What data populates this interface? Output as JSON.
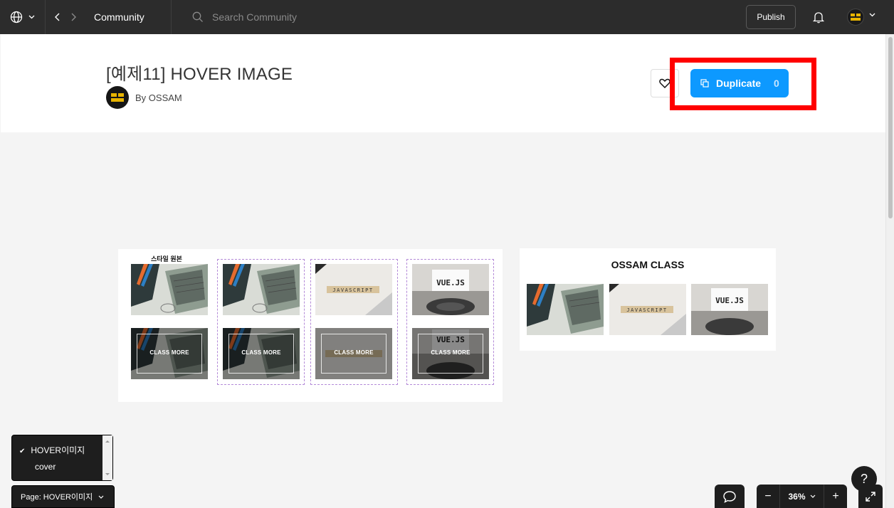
{
  "topbar": {
    "breadcrumb": "Community",
    "search_placeholder": "Search Community",
    "publish_label": "Publish"
  },
  "header": {
    "title": "[예제11] HOVER IMAGE",
    "author": "By OSSAM",
    "duplicate_label": "Duplicate",
    "duplicate_count": "0"
  },
  "canvas": {
    "style_label": "스타일 원본",
    "overlay_label": "CLASS MORE",
    "right_title": "OSSAM CLASS",
    "image_labels": {
      "javascript": "JAVASCRIPT",
      "vuejs": "VUE.JS"
    }
  },
  "pages_panel": {
    "items": [
      {
        "label": "HOVER이미지",
        "checked": true
      },
      {
        "label": "cover",
        "checked": false
      }
    ],
    "page_select": "Page: HOVER이미지"
  },
  "zoom": {
    "minus": "−",
    "value": "36%",
    "plus": "+"
  },
  "help": "?",
  "colors": {
    "topbar": "#2c2c2c",
    "accent": "#0d99ff",
    "highlight": "#ff0000"
  }
}
